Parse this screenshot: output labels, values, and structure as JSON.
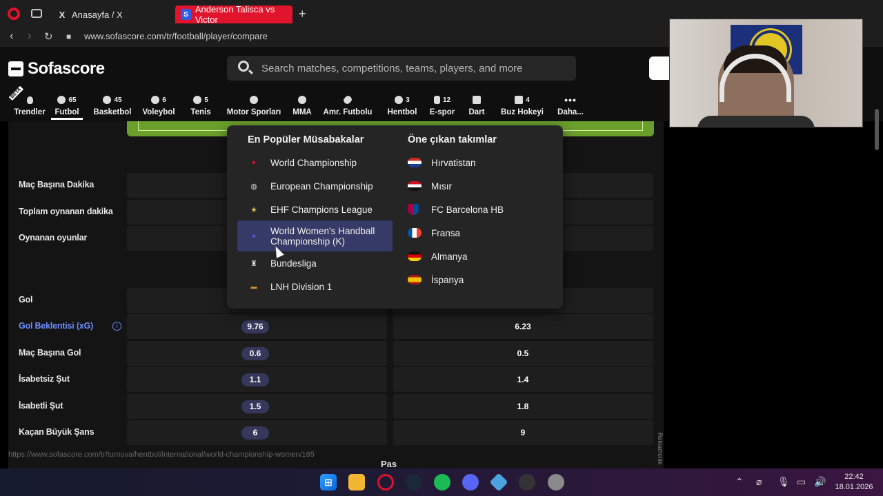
{
  "browser": {
    "tabs": [
      {
        "title": "Anasayfa / X",
        "icon": "x-logo-icon"
      },
      {
        "title": "Anderson Talisca vs Victor",
        "icon": "sofascore-favicon"
      }
    ],
    "url": "www.sofascore.com/tr/football/player/compare",
    "status_url": "https://www.sofascore.com/tr/turnuva/hentbol/international/world-championship-women/165"
  },
  "header": {
    "brand": "Sofascore",
    "search_placeholder": "Search matches, competitions, teams, players, and more"
  },
  "sports_nav": [
    {
      "label": "Trendler",
      "count": "",
      "icon": "fire-icon",
      "beta": "BETA"
    },
    {
      "label": "Futbol",
      "count": "65",
      "icon": "football-icon",
      "active": true
    },
    {
      "label": "Basketbol",
      "count": "45",
      "icon": "basketball-icon"
    },
    {
      "label": "Voleybol",
      "count": "6",
      "icon": "volleyball-icon"
    },
    {
      "label": "Tenis",
      "count": "5",
      "icon": "tennis-icon"
    },
    {
      "label": "Motor Sporları",
      "count": "",
      "icon": "helmet-icon"
    },
    {
      "label": "MMA",
      "count": "",
      "icon": "glove-icon"
    },
    {
      "label": "Amr. Futbolu",
      "count": "",
      "icon": "american-football-icon"
    },
    {
      "label": "Hentbol",
      "count": "3",
      "icon": "handball-icon"
    },
    {
      "label": "E-spor",
      "count": "12",
      "icon": "gamepad-icon"
    },
    {
      "label": "Dart",
      "count": "",
      "icon": "dart-icon"
    },
    {
      "label": "Buz Hokeyi",
      "count": "4",
      "icon": "hockey-icon"
    },
    {
      "label": "Daha...",
      "count": "",
      "icon": "more-icon"
    }
  ],
  "stats_top": [
    {
      "label": "Maç Başına Dakika"
    },
    {
      "label": "Toplam oynanan dakika"
    },
    {
      "label": "Oynanan oyunlar"
    }
  ],
  "stats_bottom": [
    {
      "label": "Gol",
      "left": "",
      "right": ""
    },
    {
      "label": "Gol Beklentisi (xG)",
      "left": "9.76",
      "right": "6.23",
      "link": true
    },
    {
      "label": "Maç Başına Gol",
      "left": "0.6",
      "right": "0.5"
    },
    {
      "label": "İsabetsiz Şut",
      "left": "1.1",
      "right": "1.4"
    },
    {
      "label": "İsabetli Şut",
      "left": "1.5",
      "right": "1.8"
    },
    {
      "label": "Kaçan Büyük Şans",
      "left": "6",
      "right": "9"
    }
  ],
  "dropdown": {
    "competitions_title": "En Popüler Müsabakalar",
    "teams_title": "Öne çıkan takımlar",
    "competitions": [
      {
        "label": "World Championship",
        "icon": "world-championship-icon"
      },
      {
        "label": "European Championship",
        "icon": "european-championship-icon"
      },
      {
        "label": "EHF Champions League",
        "icon": "ehf-star-icon"
      },
      {
        "label": "World Women's Handball Championship (K)",
        "icon": "womens-championship-icon",
        "highlighted": true
      },
      {
        "label": "Bundesliga",
        "icon": "bundesliga-icon"
      },
      {
        "label": "LNH Division 1",
        "icon": "lnh-icon"
      }
    ],
    "teams": [
      {
        "label": "Hırvatistan",
        "icon": "croatia-flag-icon"
      },
      {
        "label": "Mısır",
        "icon": "egypt-flag-icon"
      },
      {
        "label": "FC Barcelona HB",
        "icon": "barcelona-crest-icon"
      },
      {
        "label": "Fransa",
        "icon": "france-flag-icon"
      },
      {
        "label": "Almanya",
        "icon": "germany-flag-icon"
      },
      {
        "label": "İspanya",
        "icon": "spain-flag-icon"
      }
    ]
  },
  "misc": {
    "ad_label": "Reklamcılık",
    "cutoff_text": "Pas"
  },
  "taskbar": {
    "time": "22:42",
    "date": "18.01.2026"
  },
  "colors": {
    "accent": "#6b8cff",
    "pill": "#35385a",
    "highlight": "#363a66",
    "opera_red": "#e0132a"
  }
}
